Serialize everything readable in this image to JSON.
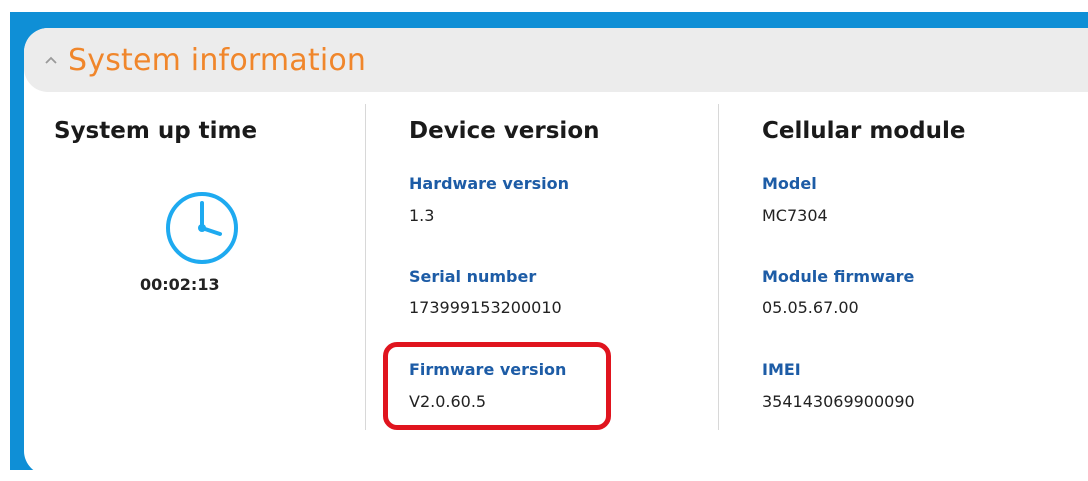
{
  "panel": {
    "title": "System information",
    "accent_color": "#f0862b",
    "border_color": "#0f8fd6",
    "collapse_icon": "chevron-up-icon"
  },
  "uptime": {
    "title": "System up time",
    "icon": "clock-icon",
    "value": "00:02:13"
  },
  "device": {
    "title": "Device version",
    "fields": [
      {
        "label": "Hardware version",
        "value": "1.3"
      },
      {
        "label": "Serial number",
        "value": "173999153200010"
      },
      {
        "label": "Firmware version",
        "value": "V2.0.60.5"
      }
    ]
  },
  "cellular": {
    "title": "Cellular module",
    "fields": [
      {
        "label": "Model",
        "value": "MC7304"
      },
      {
        "label": "Module firmware",
        "value": "05.05.67.00"
      },
      {
        "label": "IMEI",
        "value": "354143069900090"
      }
    ]
  },
  "highlight_color": "#e0141e"
}
